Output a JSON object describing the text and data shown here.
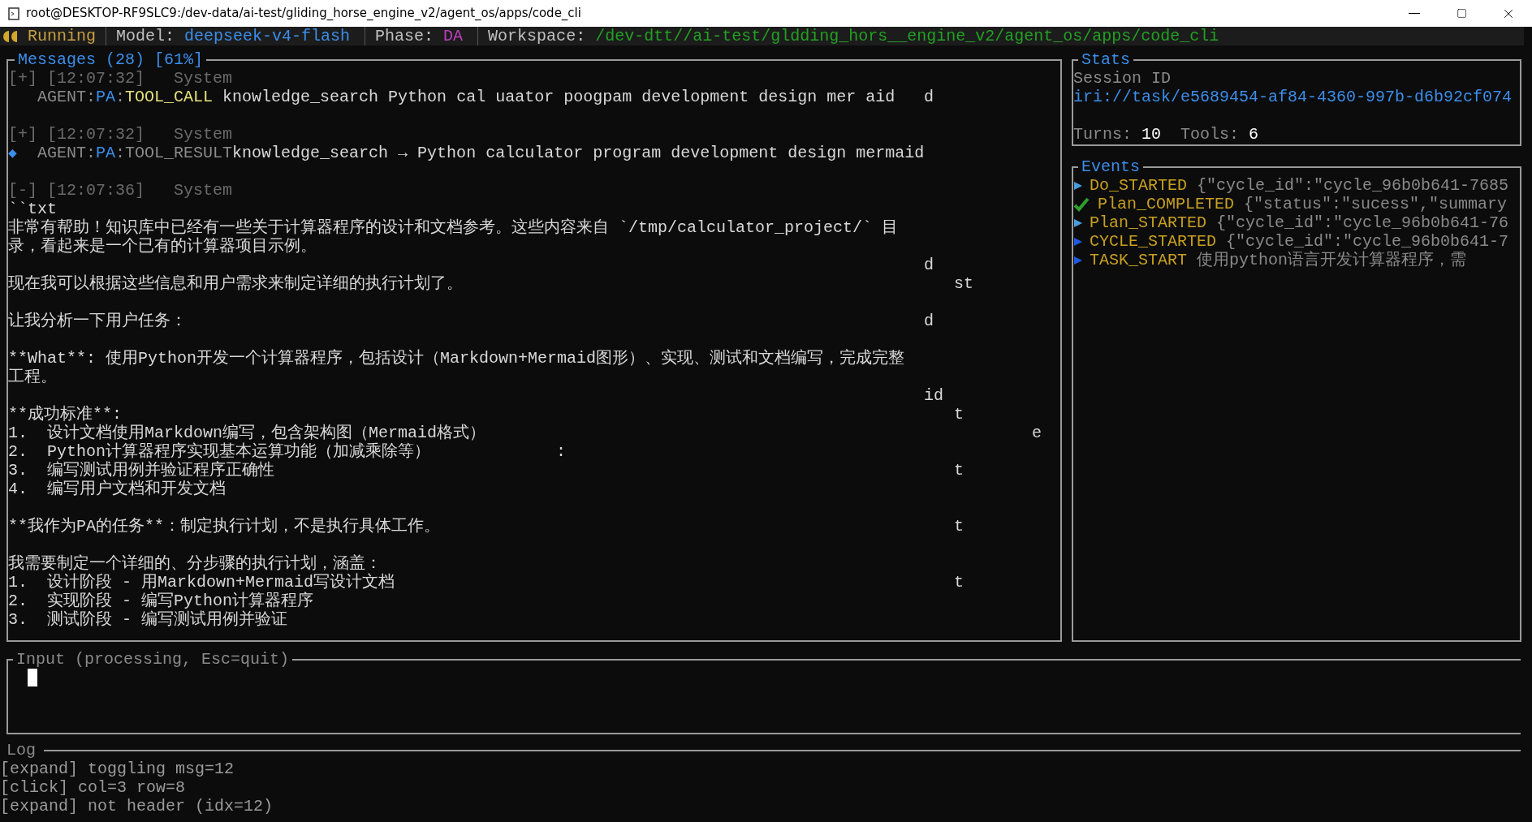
{
  "window": {
    "title": "root@DESKTOP-RF9SLC9:/dev-data/ai-test/gliding_horse_engine_v2/agent_os/apps/code_cli"
  },
  "status_bar": {
    "state": "Running",
    "items": [
      {
        "label": "Model:",
        "value": "deepseek-v4-flash",
        "color": "#3b8eea"
      },
      {
        "label": "Phase:",
        "value": "DA",
        "color": "#bc3fbc"
      },
      {
        "label": "Workspace:",
        "value": "/dev-dtt//ai-test/gldding_hors__engine_v2/agent_os/apps/code_cli",
        "color": "#23a023"
      }
    ]
  },
  "messages": {
    "title": "Messages (28) [61%]",
    "entries": [
      {
        "toggle": "[+]",
        "time": "[12:07:32]",
        "sender": "System",
        "lines": [
          {
            "segments": [
              {
                "text": "AGENT:",
                "color": "#8a8a8a"
              },
              {
                "text": "PA",
                "color": "#3b8eea"
              },
              {
                "text": ":",
                "color": "#8a8a8a"
              },
              {
                "text": "TOOL_CALL",
                "color": "#e5e07a"
              },
              {
                "text": " knowledge_search Python cal uaator poogpam development design mer aid",
                "color": "#d8d8d8"
              }
            ],
            "tail_mid": "d"
          }
        ]
      },
      {
        "toggle": "[+]",
        "time": "[12:07:32]",
        "sender": "System",
        "marker": "◆",
        "lines": [
          {
            "segments": [
              {
                "text": "AGENT:",
                "color": "#8a8a8a"
              },
              {
                "text": "PA",
                "color": "#3b8eea"
              },
              {
                "text": ":",
                "color": "#8a8a8a"
              },
              {
                "text": "TOOL_RESULT",
                "color": "#8a8a8a"
              },
              {
                "text": "knowledge_search → Python calculator program development design mermaid",
                "color": "#d8d8d8"
              }
            ]
          }
        ]
      },
      {
        "toggle": "[-]",
        "time": "[12:07:36]",
        "sender": "System",
        "paragraphs": [
          [
            {
              "text": "``txt"
            },
            {
              "text": "非常有帮助！知识库中已经有一些关于计算器程序的设计和文档参考。这些内容来自 `/tmp/calculator_project/` 目"
            },
            {
              "text": "录，看起来是一个已有的计算器项目示例。"
            },
            {
              "tail_mid": "d"
            },
            {
              "text": "现在我可以根据这些信息和用户需求来制定详细的执行计划了。",
              "tail_right": "st"
            }
          ],
          [
            {
              "text": "让我分析一下用户任务：",
              "tail_mid": "d"
            }
          ],
          [
            {
              "text": "**What**: 使用Python开发一个计算器程序，包括设计（Markdown+Mermaid图形）、实现、测试和文档编写，完成完整"
            },
            {
              "text": "工程。"
            },
            {
              "tail_mid": "id"
            },
            {
              "text": "**成功标准**:",
              "tail_right": "t"
            },
            {
              "text": "1.  设计文档使用Markdown编写，包含架构图（Mermaid格式）",
              "tail_far": "e"
            },
            {
              "text": "2.  Python计算器程序实现基本运算功能（加减乘除等）",
              "tail_inner": ":"
            },
            {
              "text": "3.  编写测试用例并验证程序正确性",
              "tail_right": "t"
            },
            {
              "text": "4.  编写用户文档和开发文档"
            }
          ],
          [
            {
              "text": "**我作为PA的任务**：制定执行计划，不是执行具体工作。",
              "tail_right": "t"
            }
          ],
          [
            {
              "text": "我需要制定一个详细的、分步骤的执行计划，涵盖："
            },
            {
              "text": "1.  设计阶段 - 用Markdown+Mermaid写设计文档",
              "tail_right": "t"
            },
            {
              "text": "2.  实现阶段 - 编写Python计算器程序"
            },
            {
              "text": "3.  测试阶段 - 编写测试用例并验证"
            }
          ]
        ]
      }
    ]
  },
  "stats": {
    "title": "Stats",
    "session_label": "Session ID",
    "session_id": "iri://task/e5689454-af84-4360-997b-d6b92cf074",
    "counters": [
      {
        "label": "Turns:",
        "value": "10"
      },
      {
        "label": "Tools:",
        "value": "6"
      }
    ]
  },
  "events": {
    "title": "Events",
    "items": [
      {
        "kind": "arrow",
        "color": "#4a9ee0",
        "name": "Do_STARTED",
        "detail": "{\"cycle_id\":\"cycle_96b0b641-7685"
      },
      {
        "kind": "check",
        "color": "#2ea02e",
        "name": "Plan_COMPLETED",
        "detail": "{\"status\":\"sucess\",\"summary"
      },
      {
        "kind": "arrow",
        "color": "#4a9ee0",
        "name": "Plan_STARTED",
        "detail": "{\"cycle_id\":\"cycle_96b0b641-76"
      },
      {
        "kind": "arrow",
        "color": "#1e5ae0",
        "name": "CYCLE_STARTED",
        "detail": "{\"cycle_id\":\"cycle_96b0b641-7"
      },
      {
        "kind": "arrow",
        "color": "#1e5ae0",
        "name": "TASK_START",
        "detail": "使用python语言开发计算器程序，需"
      }
    ]
  },
  "input": {
    "title": "Input (processing, Esc=quit)"
  },
  "log": {
    "title": "Log",
    "lines": [
      "[expand] toggling msg=12",
      "[click] col=3 row=8",
      "[expand] not header (idx=12)"
    ]
  }
}
